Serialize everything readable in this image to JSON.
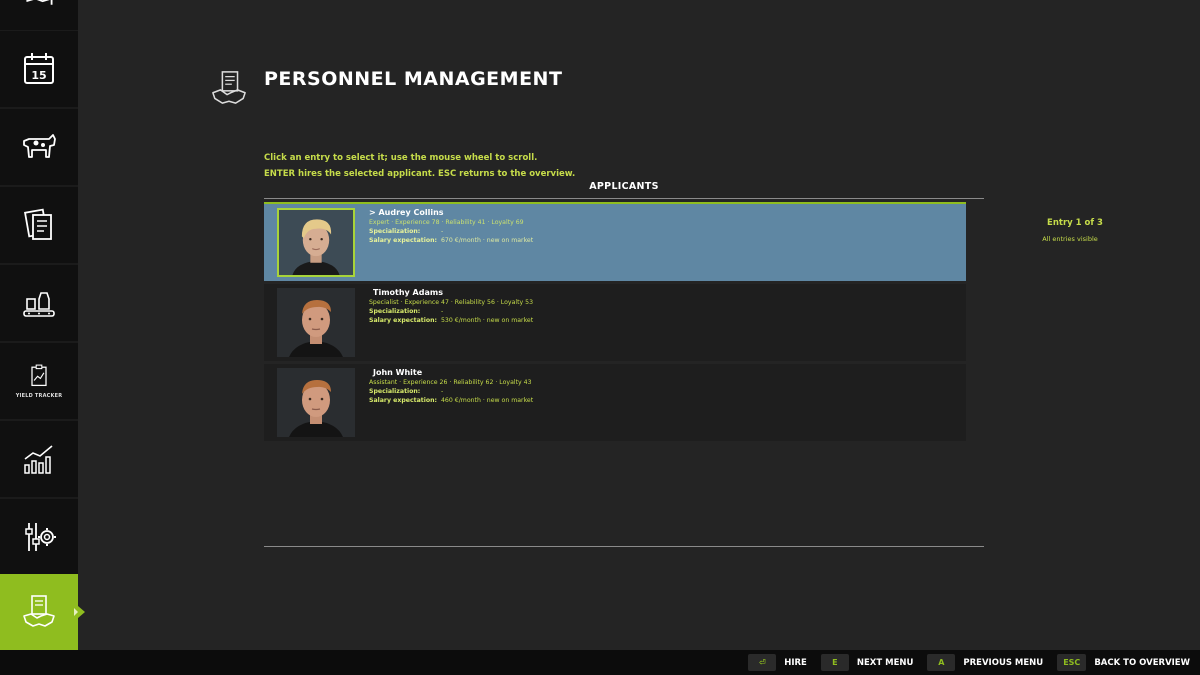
{
  "sidebar": {
    "items": [
      {
        "icon": "map-icon"
      },
      {
        "icon": "calendar-icon",
        "label": "15"
      },
      {
        "icon": "cow-icon"
      },
      {
        "icon": "contracts-icon"
      },
      {
        "icon": "production-icon"
      },
      {
        "icon": "yield-tracker-icon",
        "label": "YIELD TRACKER"
      },
      {
        "icon": "statistics-icon"
      },
      {
        "icon": "settings-icon"
      },
      {
        "icon": "personnel-icon",
        "active": true
      }
    ]
  },
  "header": {
    "title": "PERSONNEL MANAGEMENT",
    "icon": "handshake-contract-icon"
  },
  "instructions": {
    "line1": "Click an entry to select it; use the mouse wheel to scroll.",
    "line2": "ENTER hires the selected applicant. ESC returns to the overview."
  },
  "section_title": "APPLICANTS",
  "applicants": [
    {
      "name": "> Audrey Collins",
      "stats": "Expert · Experience 78 · Reliability 41 · Loyalty 69",
      "spec_label": "Specialization:",
      "spec_value": "-",
      "salary_label": "Salary expectation:",
      "salary_value": "670 €/month · new on market",
      "selected": true
    },
    {
      "name": "Timothy Adams",
      "stats": "Specialist · Experience 47 · Reliability 56 · Loyalty 53",
      "spec_label": "Specialization:",
      "spec_value": "-",
      "salary_label": "Salary expectation:",
      "salary_value": "530 €/month · new on market",
      "selected": false
    },
    {
      "name": "John White",
      "stats": "Assistant · Experience 26 · Reliability 62 · Loyalty 43",
      "spec_label": "Specialization:",
      "spec_value": "-",
      "salary_label": "Salary expectation:",
      "salary_value": "460 €/month · new on market",
      "selected": false
    }
  ],
  "entry_info": {
    "count": "Entry 1 of 3",
    "visibility": "All entries visible"
  },
  "bottom_bar": {
    "actions": [
      {
        "key": "⏎",
        "label": "HIRE"
      },
      {
        "key": "E",
        "label": "NEXT MENU"
      },
      {
        "key": "A",
        "label": "PREVIOUS MENU"
      },
      {
        "key": "ESC",
        "label": "BACK TO OVERVIEW"
      }
    ]
  },
  "colors": {
    "accent": "#8fbd1f",
    "text_accent": "#c6dc4a",
    "selected_row": "#5f87a3",
    "background": "#242424"
  }
}
